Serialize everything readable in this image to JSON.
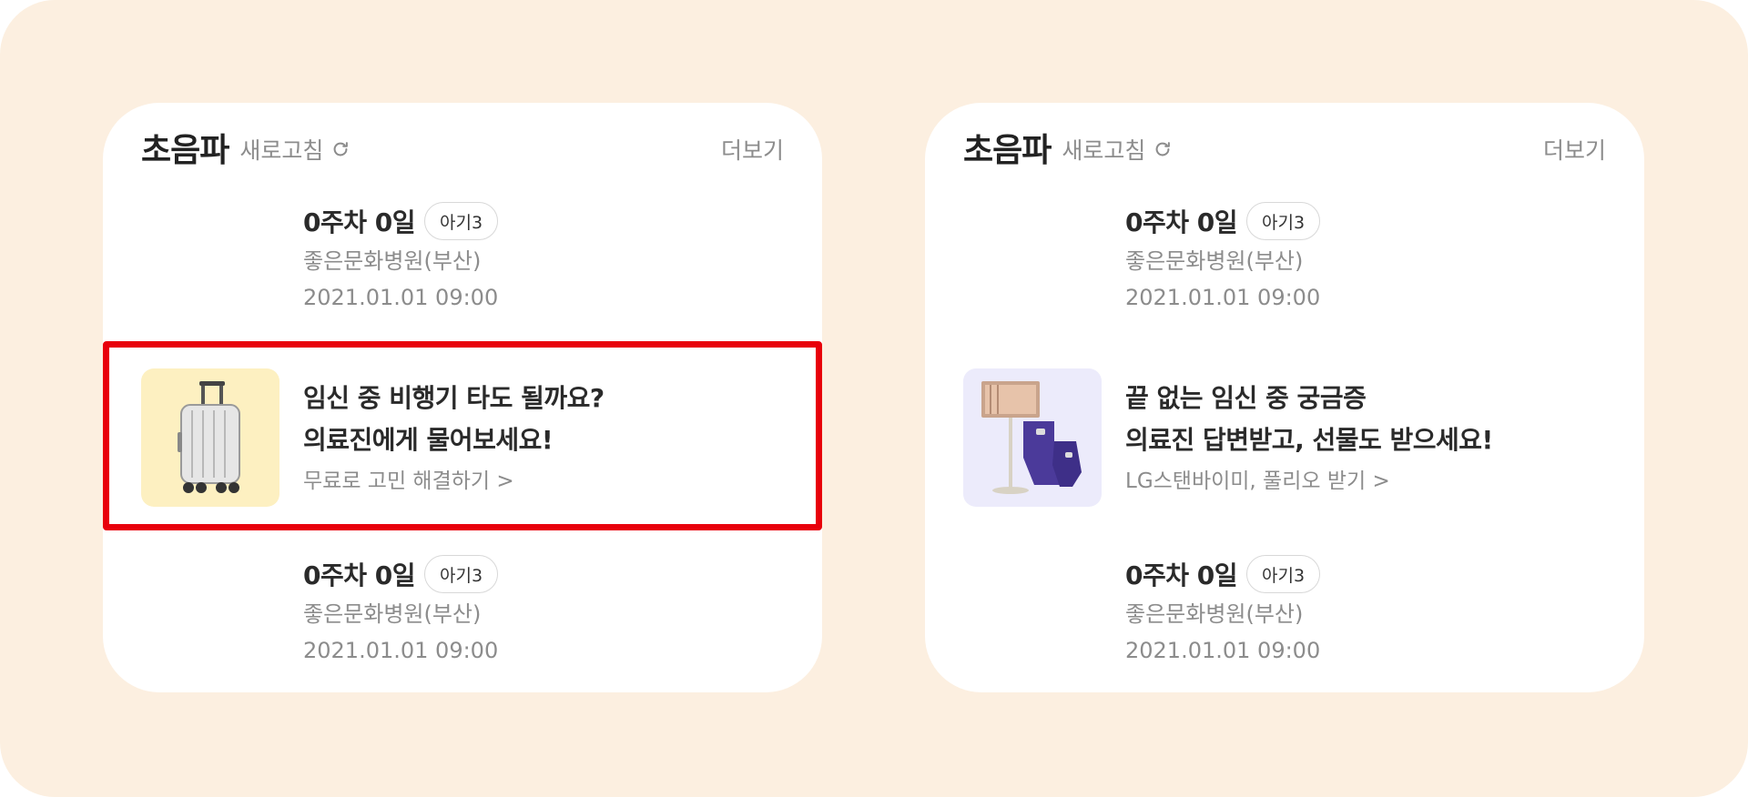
{
  "colors": {
    "page_background": "#fcefe0",
    "card_background": "#ffffff",
    "highlight_border": "#e8000b",
    "suitcase_thumb_bg": "#fdf0c1",
    "product_thumb_bg": "#ecebfb",
    "product_accent": "#4b3a9a"
  },
  "cards": [
    {
      "header": {
        "title": "초음파",
        "refresh_label": "새로고침",
        "more_label": "더보기"
      },
      "top_record": {
        "week": "0주차 0일",
        "baby": "아기3",
        "hospital": "좋은문화병원(부산)",
        "datetime": "2021.01.01 09:00"
      },
      "promo": {
        "line1": "임신 중 비행기 타도 될까요?",
        "line2": "의료진에게 물어보세요!",
        "cta": "무료로 고민 해결하기 >",
        "thumb_icon": "suitcase-icon",
        "highlighted": true
      },
      "bottom_record": {
        "week": "0주차 0일",
        "baby": "아기3",
        "hospital": "좋은문화병원(부산)",
        "datetime": "2021.01.01 09:00"
      }
    },
    {
      "header": {
        "title": "초음파",
        "refresh_label": "새로고침",
        "more_label": "더보기"
      },
      "top_record": {
        "week": "0주차 0일",
        "baby": "아기3",
        "hospital": "좋은문화병원(부산)",
        "datetime": "2021.01.01 09:00"
      },
      "promo": {
        "line1": "끝 없는 임신 중 궁금증",
        "line2": "의료진 답변받고, 선물도 받으세요!",
        "cta": "LG스탠바이미, 풀리오 받기 >",
        "thumb_icon": "product-gift-icon",
        "highlighted": false
      },
      "bottom_record": {
        "week": "0주차 0일",
        "baby": "아기3",
        "hospital": "좋은문화병원(부산)",
        "datetime": "2021.01.01 09:00"
      }
    }
  ]
}
